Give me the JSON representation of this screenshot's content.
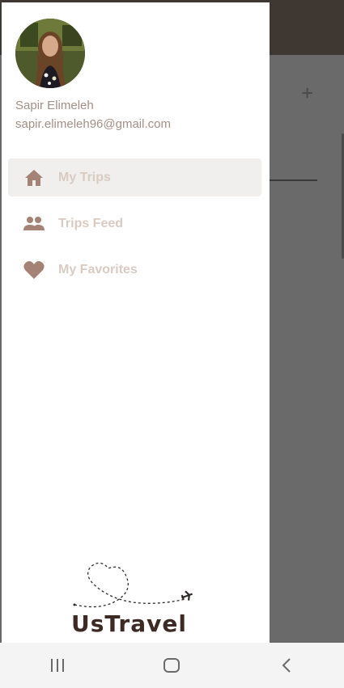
{
  "user": {
    "name": "Sapir Elimeleh",
    "email": "sapir.elimeleh96@gmail.com"
  },
  "menu": [
    {
      "label": "My Trips",
      "icon": "home-icon",
      "active": true
    },
    {
      "label": "Trips Feed",
      "icon": "people-icon",
      "active": false
    },
    {
      "label": "My Favorites",
      "icon": "heart-icon",
      "active": false
    }
  ],
  "logo": {
    "text": "UsTravel"
  },
  "background": {
    "plus_label": "+"
  },
  "colors": {
    "accent": "#a48275",
    "menu_text": "#d9cbc2",
    "logo_text": "#3d2a25",
    "header_bg": "#3f3732"
  },
  "navbar": {
    "icons": [
      "recent-apps-icon",
      "home-button-icon",
      "back-icon"
    ]
  }
}
